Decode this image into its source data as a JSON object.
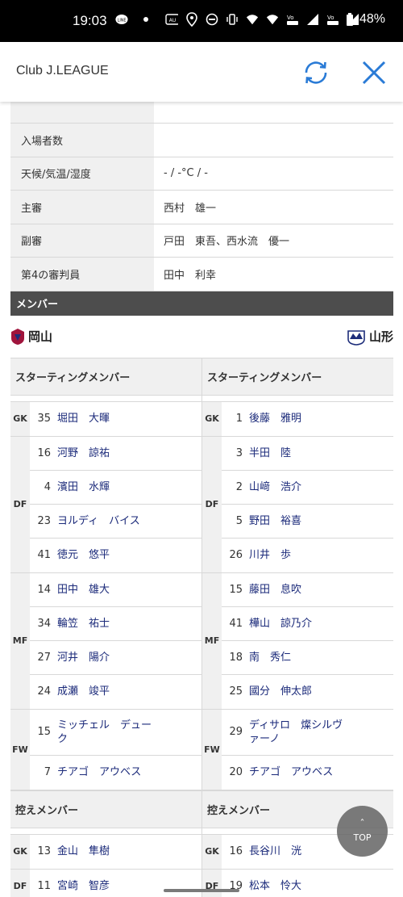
{
  "status_bar": {
    "time": "19:03",
    "battery": "48%",
    "icons": [
      "line-icon",
      "dot-icon",
      "auto-icon",
      "location-icon",
      "dnd-icon",
      "vibrate-icon",
      "wifi-icon",
      "wifi2-icon",
      "volte1-icon",
      "signal1-icon",
      "volte2-icon",
      "signal2-icon",
      "battery-icon"
    ]
  },
  "app_bar": {
    "title": "Club J.LEAGUE",
    "accent": "#2a7bd6"
  },
  "match_info": [
    {
      "label": "",
      "value": ""
    },
    {
      "label": "入場者数",
      "value": ""
    },
    {
      "label": "天候/気温/湿度",
      "value": "- / -°C / -"
    },
    {
      "label": "主審",
      "value": "西村　雄一"
    },
    {
      "label": "副審",
      "value": "戸田　東吾、西水流　優一"
    },
    {
      "label": "第4の審判員",
      "value": "田中　利幸"
    }
  ],
  "members_section": "メンバー",
  "home_team": "岡山",
  "away_team": "山形",
  "starting_label": "スターティングメンバー",
  "sub_label": "控えメンバー",
  "home_starting": [
    {
      "pos": "GK",
      "players": [
        {
          "num": "35",
          "name": "堀田　大暉"
        }
      ]
    },
    {
      "pos": "DF",
      "players": [
        {
          "num": "16",
          "name": "河野　諒祐"
        },
        {
          "num": "4",
          "name": "濱田　水輝"
        },
        {
          "num": "23",
          "name": "ヨルディ　バイス"
        },
        {
          "num": "41",
          "name": "徳元　悠平"
        }
      ]
    },
    {
      "pos": "MF",
      "players": [
        {
          "num": "14",
          "name": "田中　雄大"
        },
        {
          "num": "34",
          "name": "輪笠　祐士"
        },
        {
          "num": "27",
          "name": "河井　陽介"
        },
        {
          "num": "24",
          "name": "成瀬　竣平"
        }
      ]
    },
    {
      "pos": "FW",
      "players": [
        {
          "num": "15",
          "name": "ミッチェル　デューク"
        },
        {
          "num": "7",
          "name": "チアゴ　アウベス"
        }
      ]
    }
  ],
  "away_starting": [
    {
      "pos": "GK",
      "players": [
        {
          "num": "1",
          "name": "後藤　雅明"
        }
      ]
    },
    {
      "pos": "DF",
      "players": [
        {
          "num": "3",
          "name": "半田　陸"
        },
        {
          "num": "2",
          "name": "山﨑　浩介"
        },
        {
          "num": "5",
          "name": "野田　裕喜"
        },
        {
          "num": "26",
          "name": "川井　歩"
        }
      ]
    },
    {
      "pos": "MF",
      "players": [
        {
          "num": "15",
          "name": "藤田　息吹"
        },
        {
          "num": "41",
          "name": "樺山　諒乃介"
        },
        {
          "num": "18",
          "name": "南　秀仁"
        },
        {
          "num": "25",
          "name": "國分　伸太郎"
        }
      ]
    },
    {
      "pos": "FW",
      "players": [
        {
          "num": "29",
          "name": "ディサロ　燦シルヴァーノ"
        },
        {
          "num": "20",
          "name": "チアゴ　アウベス"
        }
      ]
    }
  ],
  "home_subs": [
    {
      "pos": "GK",
      "players": [
        {
          "num": "13",
          "name": "金山　隼樹"
        }
      ]
    },
    {
      "pos": "DF",
      "players": [
        {
          "num": "11",
          "name": "宮崎　智彦"
        }
      ]
    }
  ],
  "away_subs": [
    {
      "pos": "GK",
      "players": [
        {
          "num": "16",
          "name": "長谷川　洸"
        }
      ]
    },
    {
      "pos": "DF",
      "players": [
        {
          "num": "19",
          "name": "松本　怜大"
        }
      ]
    }
  ],
  "top_button": "TOP"
}
